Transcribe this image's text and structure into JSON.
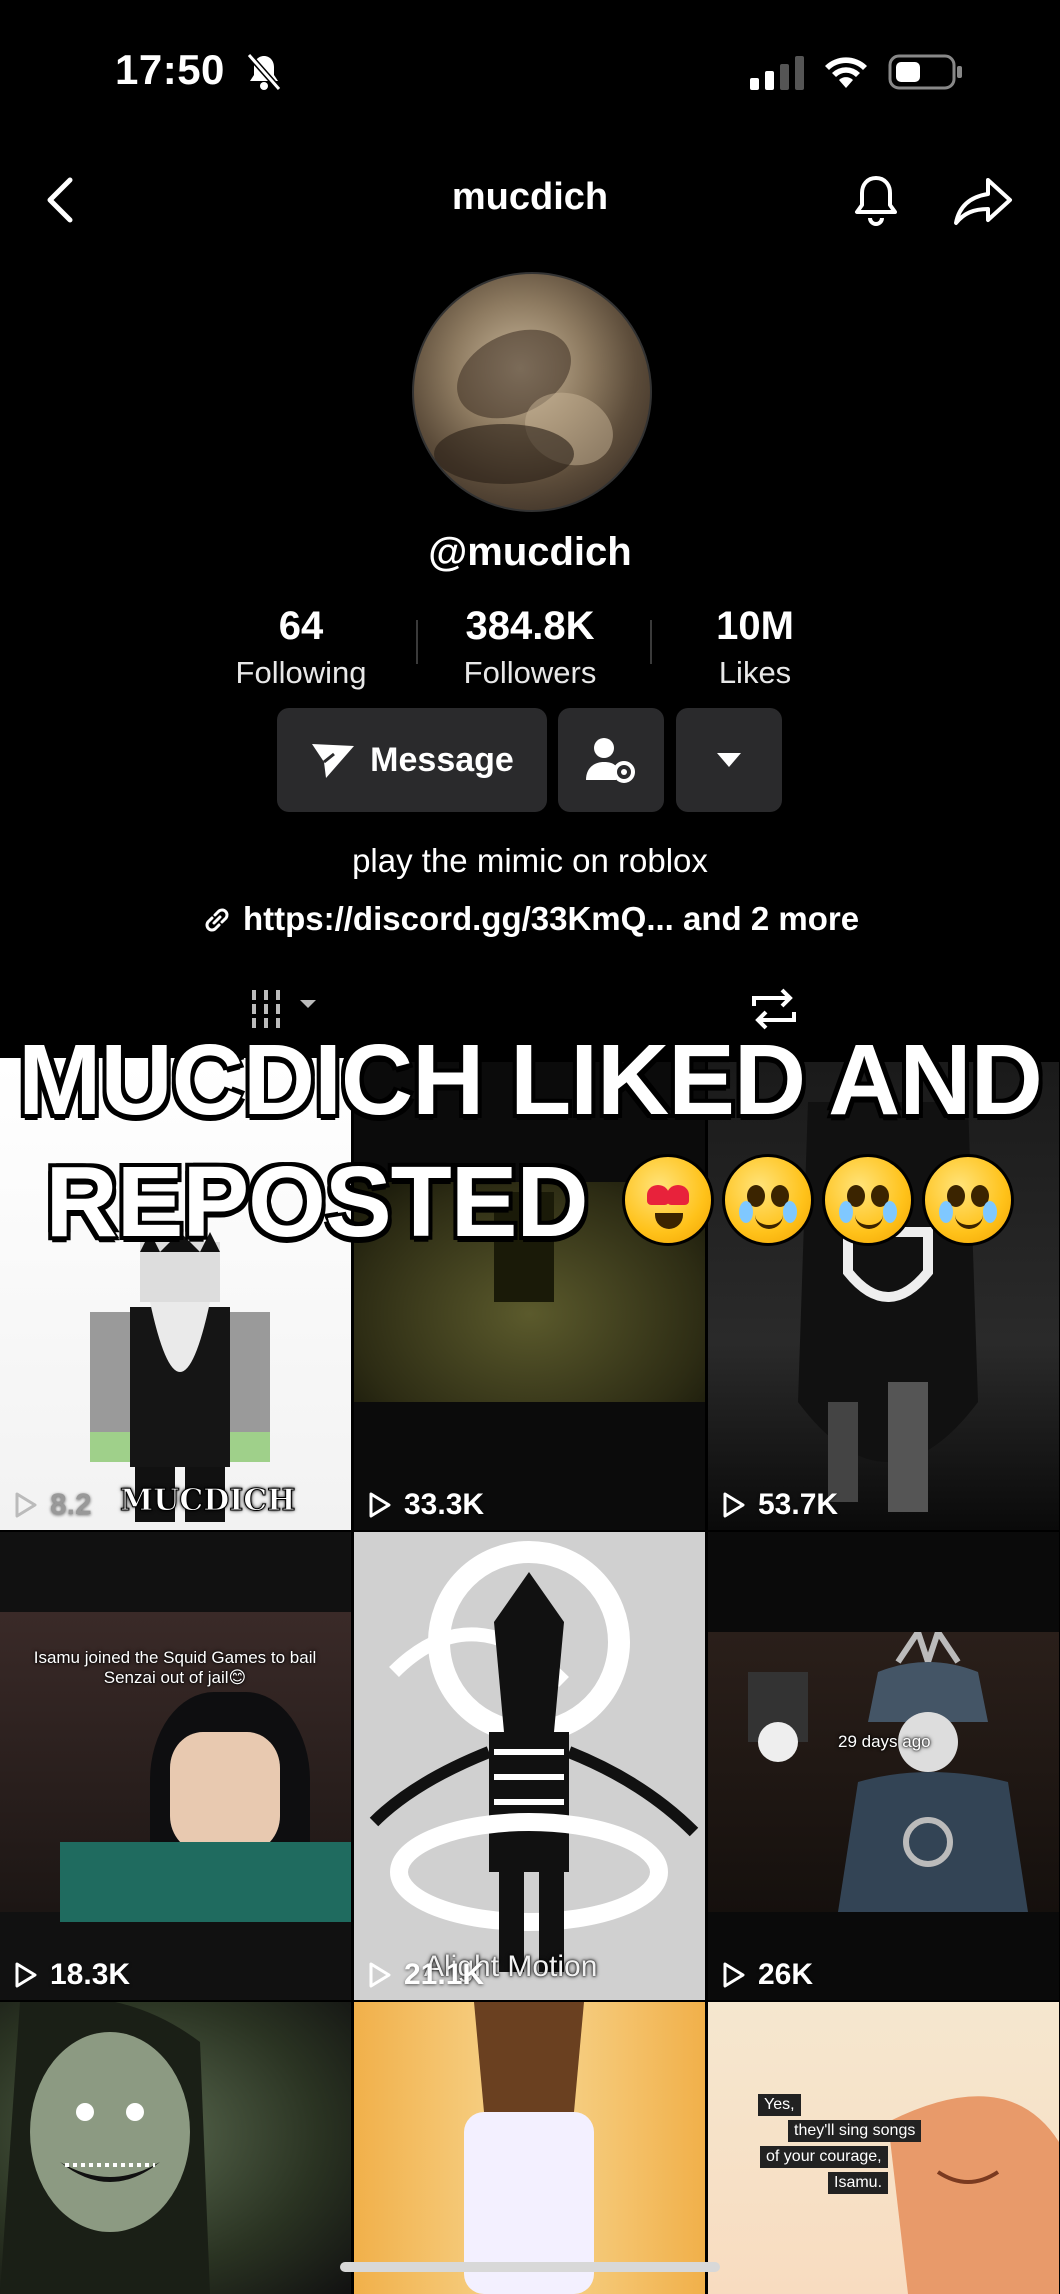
{
  "status_bar": {
    "time": "17:50"
  },
  "header": {
    "title": "mucdich"
  },
  "profile": {
    "handle": "@mucdich",
    "stats": [
      {
        "value": "64",
        "label": "Following"
      },
      {
        "value": "384.8K",
        "label": "Followers"
      },
      {
        "value": "10M",
        "label": "Likes"
      }
    ],
    "message_label": "Message",
    "bio": "play the mimic on roblox",
    "link": "https://discord.gg/33KmQ... and 2 more"
  },
  "videos": [
    {
      "views": "8.2",
      "caption": "MUCDICH"
    },
    {
      "views": "33.3K"
    },
    {
      "views": "53.7K"
    },
    {
      "views": "18.3K",
      "caption": "Isamu joined the Squid Games to bail Senzai out of jail😊"
    },
    {
      "views": "21.1K",
      "caption": "Alight Motion"
    },
    {
      "views": "26K",
      "caption": "29 days ago"
    },
    {
      "views": ""
    },
    {
      "views": ""
    },
    {
      "views": "",
      "caption_lines": [
        "Yes,",
        "they'll sing songs",
        "of your courage,",
        "Isamu."
      ]
    }
  ],
  "overlay": {
    "line1": "MUCDICH LIKED AND",
    "line2": "REPOSTED"
  },
  "colors": {
    "background": "#000000",
    "button": "#2a2a2c",
    "text": "#ffffff"
  }
}
